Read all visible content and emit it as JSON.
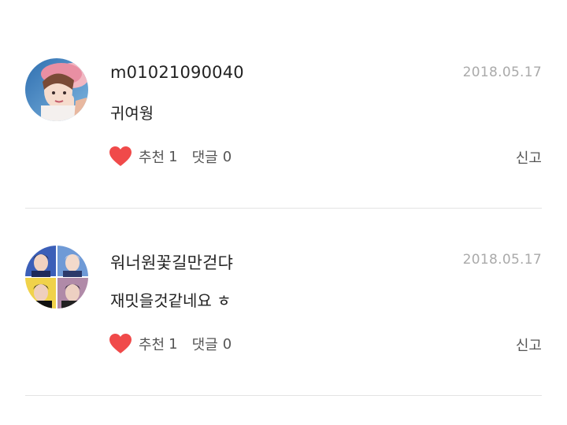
{
  "comments": [
    {
      "username": "m01021090040",
      "date": "2018.05.17",
      "text": "귀여웡",
      "like_label": "추천",
      "like_count": "1",
      "reply_label": "댓글",
      "reply_count": "0",
      "report_label": "신고"
    },
    {
      "username": "워너원꽃길만걷댜",
      "date": "2018.05.17",
      "text": "재밋을것같네요 ㅎ",
      "like_label": "추천",
      "like_count": "1",
      "reply_label": "댓글",
      "reply_count": "0",
      "report_label": "신고"
    }
  ],
  "colors": {
    "heart": "#f04a4a",
    "divider": "#e3e3e3",
    "date": "#aaaaaa"
  },
  "icons": {
    "like": "heart-icon"
  }
}
